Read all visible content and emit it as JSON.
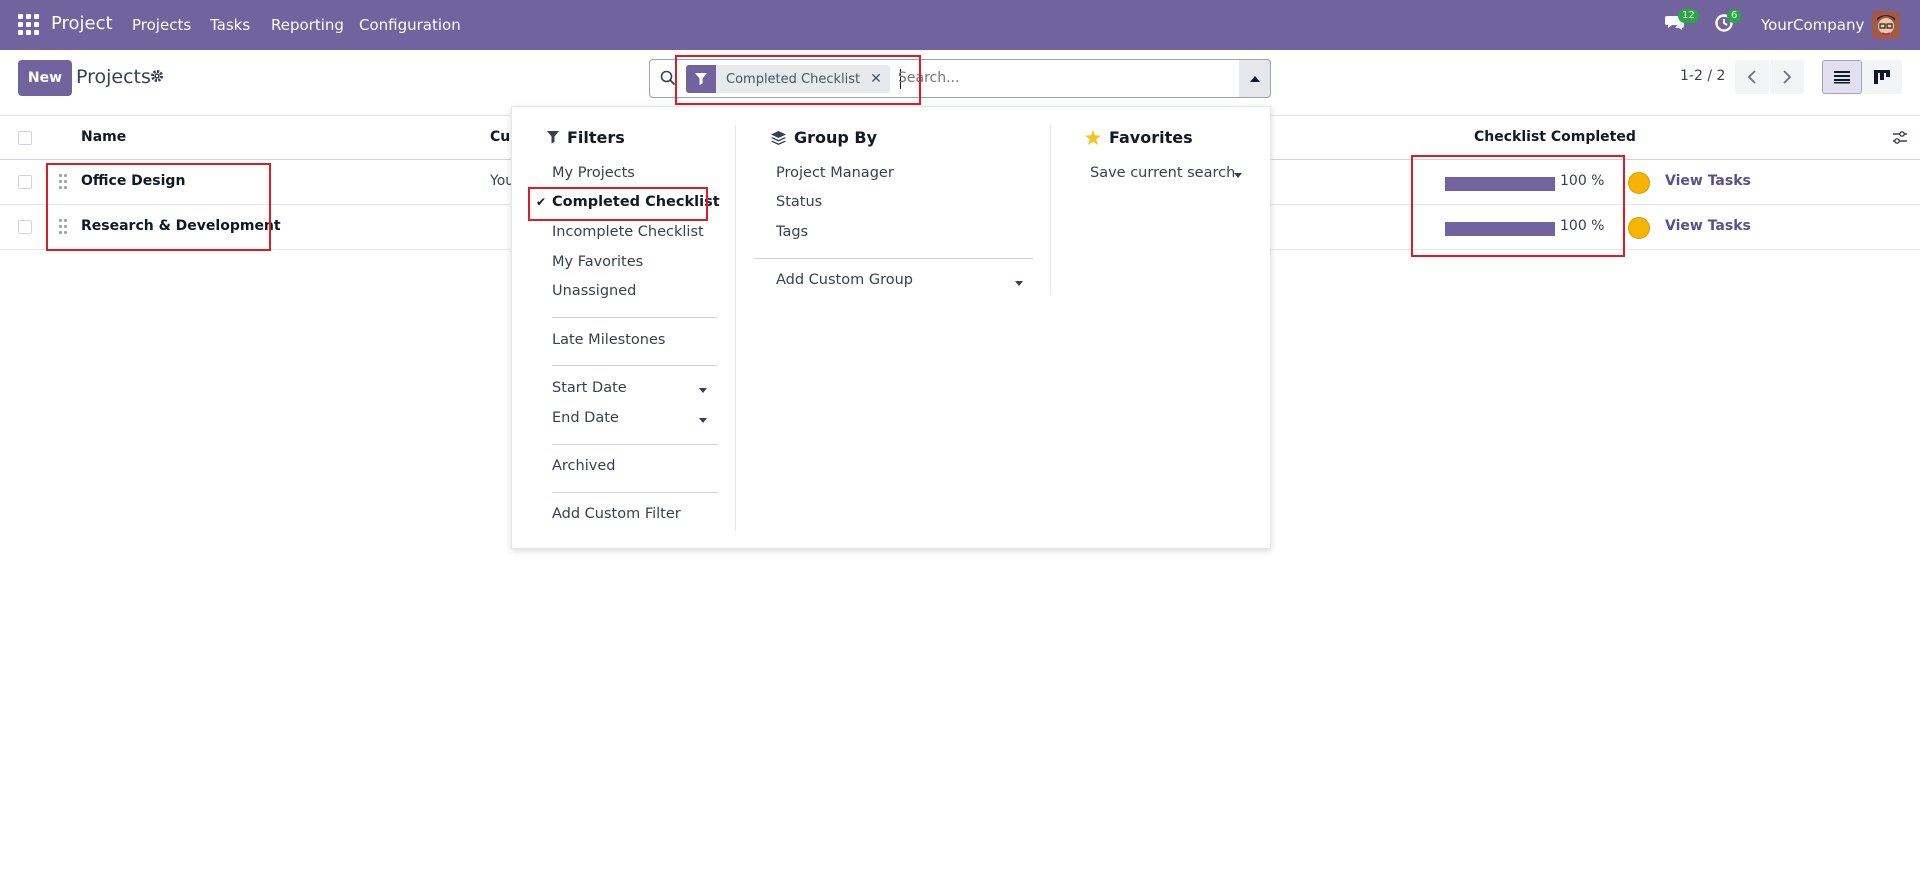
{
  "topbar": {
    "app_name": "Project",
    "nav": [
      "Projects",
      "Tasks",
      "Reporting",
      "Configuration"
    ],
    "messages_count": "12",
    "activities_count": "6",
    "company": "YourCompany",
    "bg_color": "#71639e"
  },
  "control": {
    "new_label": "New",
    "title": "Projects",
    "facet_label": "Completed Checklist",
    "search_placeholder": "Search...",
    "pager": "1-2 / 2"
  },
  "table": {
    "columns": [
      "Name",
      "Cus",
      "Checklist Completed"
    ],
    "rows": [
      {
        "name": "Office Design",
        "customer": "You",
        "progress": 100,
        "pct_label": "100 %",
        "action": "View Tasks"
      },
      {
        "name": "Research & Development",
        "customer": "",
        "progress": 100,
        "pct_label": "100 %",
        "action": "View Tasks"
      }
    ]
  },
  "dropdown": {
    "filters": {
      "title": "Filters",
      "items": [
        "My Projects",
        "Completed Checklist",
        "Incomplete Checklist",
        "My Favorites",
        "Unassigned",
        "Late Milestones",
        "Start Date",
        "End Date",
        "Archived",
        "Add Custom Filter"
      ],
      "checked": "Completed Checklist"
    },
    "groupby": {
      "title": "Group By",
      "items": [
        "Project Manager",
        "Status",
        "Tags",
        "Add Custom Group"
      ]
    },
    "favorites": {
      "title": "Favorites",
      "items": [
        "Save current search"
      ]
    }
  }
}
